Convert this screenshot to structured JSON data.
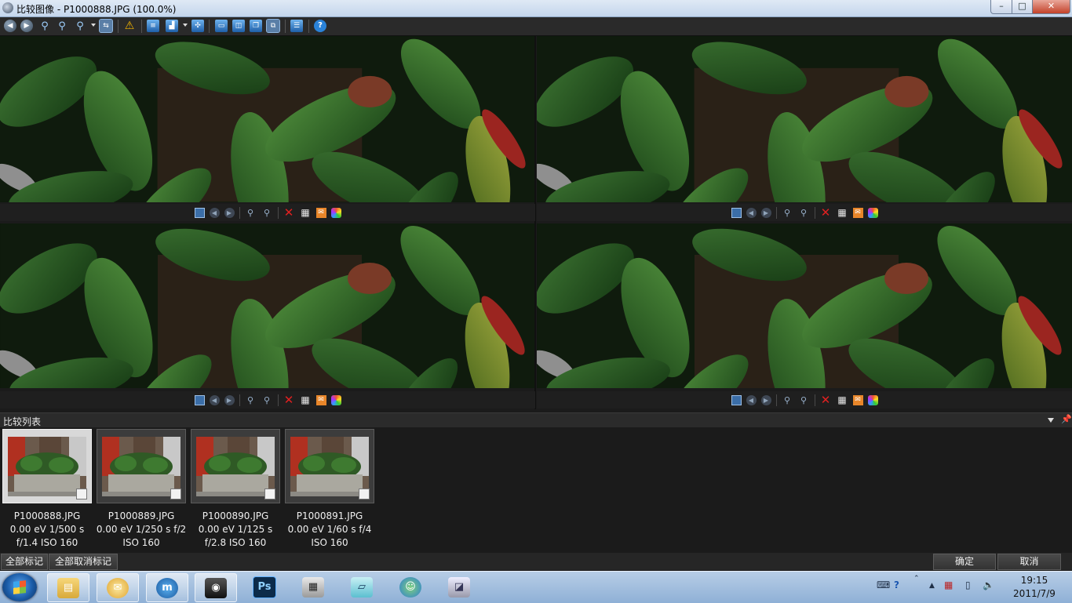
{
  "window": {
    "title": "比较图像 - P1000888.JPG (100.0%)",
    "min": "0",
    "max": "1",
    "close": "r"
  },
  "toolbar_icons": [
    "back-circle-icon",
    "forward-circle-icon",
    "zoom-in-icon",
    "zoom-out-icon",
    "zoom-icon",
    "sync-lock-icon",
    "warning-icon",
    "list-view-icon",
    "histogram-icon",
    "network-icon",
    "single-view-icon",
    "two-view-icon",
    "three-view-icon",
    "four-view-icon",
    "info-panel-icon",
    "help-icon"
  ],
  "panes": [
    {
      "name": "P1000888.JPG",
      "selected": true
    },
    {
      "name": "P1000889.JPG",
      "selected": false
    },
    {
      "name": "P1000890.JPG",
      "selected": false
    },
    {
      "name": "P1000891.JPG",
      "selected": false
    }
  ],
  "compare_list": {
    "title": "比较列表",
    "items": [
      {
        "file": "P1000888.JPG",
        "line1": "0.00 eV 1/500 s",
        "line2": "f/1.4 ISO 160",
        "selected": true
      },
      {
        "file": "P1000889.JPG",
        "line1": "0.00 eV 1/250 s f/2",
        "line2": "ISO 160",
        "selected": false
      },
      {
        "file": "P1000890.JPG",
        "line1": "0.00 eV 1/125 s",
        "line2": "f/2.8 ISO 160",
        "selected": false
      },
      {
        "file": "P1000891.JPG",
        "line1": "0.00 eV 1/60 s f/4",
        "line2": "ISO 160",
        "selected": false
      }
    ]
  },
  "buttons": {
    "mark_all": "全部标记",
    "unmark_all": "全部取消标记",
    "ok": "确定",
    "cancel": "取消"
  },
  "taskbar": {
    "photoshop_label": "Ps",
    "time": "19:15",
    "date": "2011/7/9"
  },
  "colors": {
    "background": "#1b1b1b",
    "toolbar": "#2a2a2a",
    "selection_outline": "#d9d9d9",
    "delete_red": "#e02020"
  }
}
